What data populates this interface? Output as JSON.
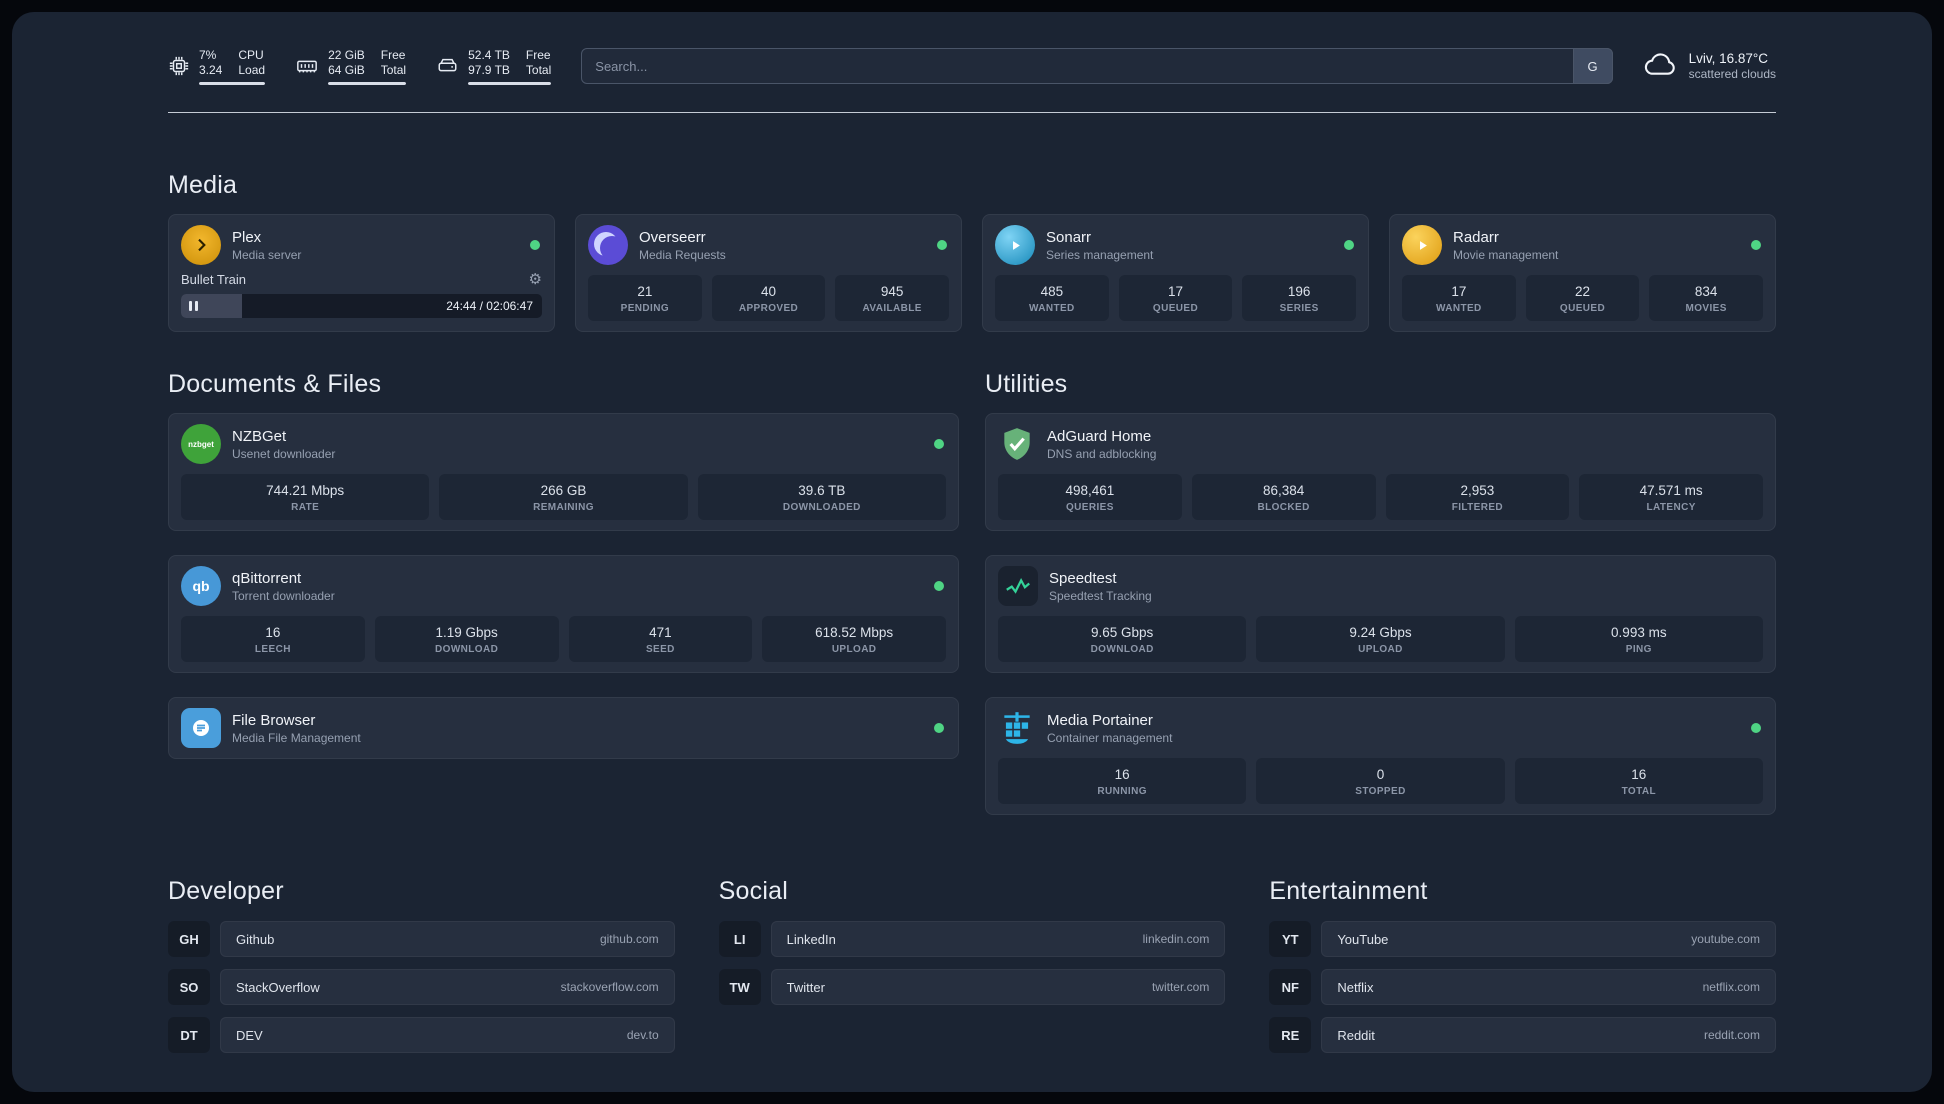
{
  "topbar": {
    "cpu": {
      "value_top": "7%",
      "value_bottom": "3.24",
      "label_top": "CPU",
      "label_bottom": "Load",
      "bar_pct": 100
    },
    "memory": {
      "value_top": "22 GiB",
      "value_bottom": "64 GiB",
      "label_top": "Free",
      "label_bottom": "Total",
      "bar_pct": 100
    },
    "disk": {
      "value_top": "52.4 TB",
      "value_bottom": "97.9 TB",
      "label_top": "Free",
      "label_bottom": "Total",
      "bar_pct": 100
    },
    "search": {
      "placeholder": "Search...",
      "button_label": "G"
    },
    "weather": {
      "location": "Lviv, 16.87°C",
      "condition": "scattered clouds"
    }
  },
  "media": {
    "title": "Media",
    "plex": {
      "name": "Plex",
      "subtitle": "Media server",
      "now_playing": "Bullet Train",
      "time": "24:44 / 02:06:47",
      "progress_pct": 17
    },
    "overseerr": {
      "name": "Overseerr",
      "subtitle": "Media Requests",
      "stats": [
        {
          "value": "21",
          "label": "PENDING"
        },
        {
          "value": "40",
          "label": "APPROVED"
        },
        {
          "value": "945",
          "label": "AVAILABLE"
        }
      ]
    },
    "sonarr": {
      "name": "Sonarr",
      "subtitle": "Series management",
      "stats": [
        {
          "value": "485",
          "label": "WANTED"
        },
        {
          "value": "17",
          "label": "QUEUED"
        },
        {
          "value": "196",
          "label": "SERIES"
        }
      ]
    },
    "radarr": {
      "name": "Radarr",
      "subtitle": "Movie management",
      "stats": [
        {
          "value": "17",
          "label": "WANTED"
        },
        {
          "value": "22",
          "label": "QUEUED"
        },
        {
          "value": "834",
          "label": "MOVIES"
        }
      ]
    }
  },
  "documents": {
    "title": "Documents & Files",
    "nzbget": {
      "name": "NZBGet",
      "subtitle": "Usenet downloader",
      "icon_text": "nzbget",
      "stats": [
        {
          "value": "744.21 Mbps",
          "label": "RATE"
        },
        {
          "value": "266 GB",
          "label": "REMAINING"
        },
        {
          "value": "39.6 TB",
          "label": "DOWNLOADED"
        }
      ]
    },
    "qbittorrent": {
      "name": "qBittorrent",
      "subtitle": "Torrent downloader",
      "icon_text": "qb",
      "stats": [
        {
          "value": "16",
          "label": "LEECH"
        },
        {
          "value": "1.19 Gbps",
          "label": "DOWNLOAD"
        },
        {
          "value": "471",
          "label": "SEED"
        },
        {
          "value": "618.52 Mbps",
          "label": "UPLOAD"
        }
      ]
    },
    "filebrowser": {
      "name": "File Browser",
      "subtitle": "Media File Management"
    }
  },
  "utilities": {
    "title": "Utilities",
    "adguard": {
      "name": "AdGuard Home",
      "subtitle": "DNS and adblocking",
      "stats": [
        {
          "value": "498,461",
          "label": "QUERIES"
        },
        {
          "value": "86,384",
          "label": "BLOCKED"
        },
        {
          "value": "2,953",
          "label": "FILTERED"
        },
        {
          "value": "47.571 ms",
          "label": "LATENCY"
        }
      ]
    },
    "speedtest": {
      "name": "Speedtest",
      "subtitle": "Speedtest Tracking",
      "stats": [
        {
          "value": "9.65 Gbps",
          "label": "DOWNLOAD"
        },
        {
          "value": "9.24 Gbps",
          "label": "UPLOAD"
        },
        {
          "value": "0.993 ms",
          "label": "PING"
        }
      ]
    },
    "portainer": {
      "name": "Media Portainer",
      "subtitle": "Container management",
      "stats": [
        {
          "value": "16",
          "label": "RUNNING"
        },
        {
          "value": "0",
          "label": "STOPPED"
        },
        {
          "value": "16",
          "label": "TOTAL"
        }
      ]
    }
  },
  "bookmarks": [
    {
      "title": "Developer",
      "items": [
        {
          "abbr": "GH",
          "name": "Github",
          "domain": "github.com"
        },
        {
          "abbr": "SO",
          "name": "StackOverflow",
          "domain": "stackoverflow.com"
        },
        {
          "abbr": "DT",
          "name": "DEV",
          "domain": "dev.to"
        }
      ]
    },
    {
      "title": "Social",
      "items": [
        {
          "abbr": "LI",
          "name": "LinkedIn",
          "domain": "linkedin.com"
        },
        {
          "abbr": "TW",
          "name": "Twitter",
          "domain": "twitter.com"
        }
      ]
    },
    {
      "title": "Entertainment",
      "items": [
        {
          "abbr": "YT",
          "name": "YouTube",
          "domain": "youtube.com"
        },
        {
          "abbr": "NF",
          "name": "Netflix",
          "domain": "netflix.com"
        },
        {
          "abbr": "RE",
          "name": "Reddit",
          "domain": "reddit.com"
        }
      ]
    }
  ]
}
